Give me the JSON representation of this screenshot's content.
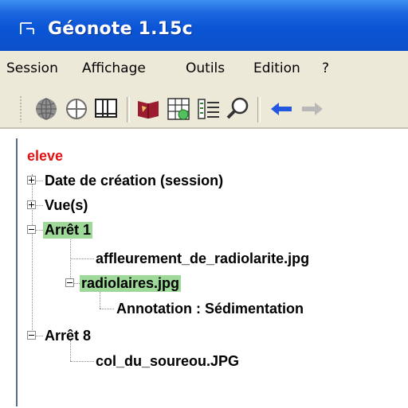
{
  "window": {
    "title": "Géonote 1.15c"
  },
  "menubar": {
    "items": [
      "Session",
      "Affichage",
      "Outils",
      "Edition",
      "?"
    ]
  },
  "toolbar": {
    "buttons": [
      "globe-icon",
      "target-circle-icon",
      "split-view-icon",
      "book-icon",
      "table-grid-icon",
      "list-icon",
      "magnifier-icon",
      "back-arrow-icon",
      "forward-arrow-icon"
    ]
  },
  "tree": {
    "root": "eleve",
    "nodes": [
      {
        "label": "Date de création (session)",
        "expanded": false
      },
      {
        "label": "Vue(s)",
        "expanded": false
      },
      {
        "label": "Arrêt 1",
        "expanded": true,
        "highlighted": true,
        "children": [
          {
            "label": "affleurement_de_radiolarite.jpg"
          },
          {
            "label": "radiolaires.jpg",
            "expanded": true,
            "highlighted": true,
            "children": [
              {
                "label": "Annotation : Sédimentation"
              }
            ]
          }
        ]
      },
      {
        "label": "Arrêt 8",
        "expanded": true,
        "children": [
          {
            "label": "col_du_soureou.JPG"
          }
        ]
      }
    ]
  },
  "colors": {
    "titlebar": "#0a55d6",
    "root_text": "#e01212",
    "highlight": "#9fd99a",
    "chrome": "#ece9d8"
  }
}
